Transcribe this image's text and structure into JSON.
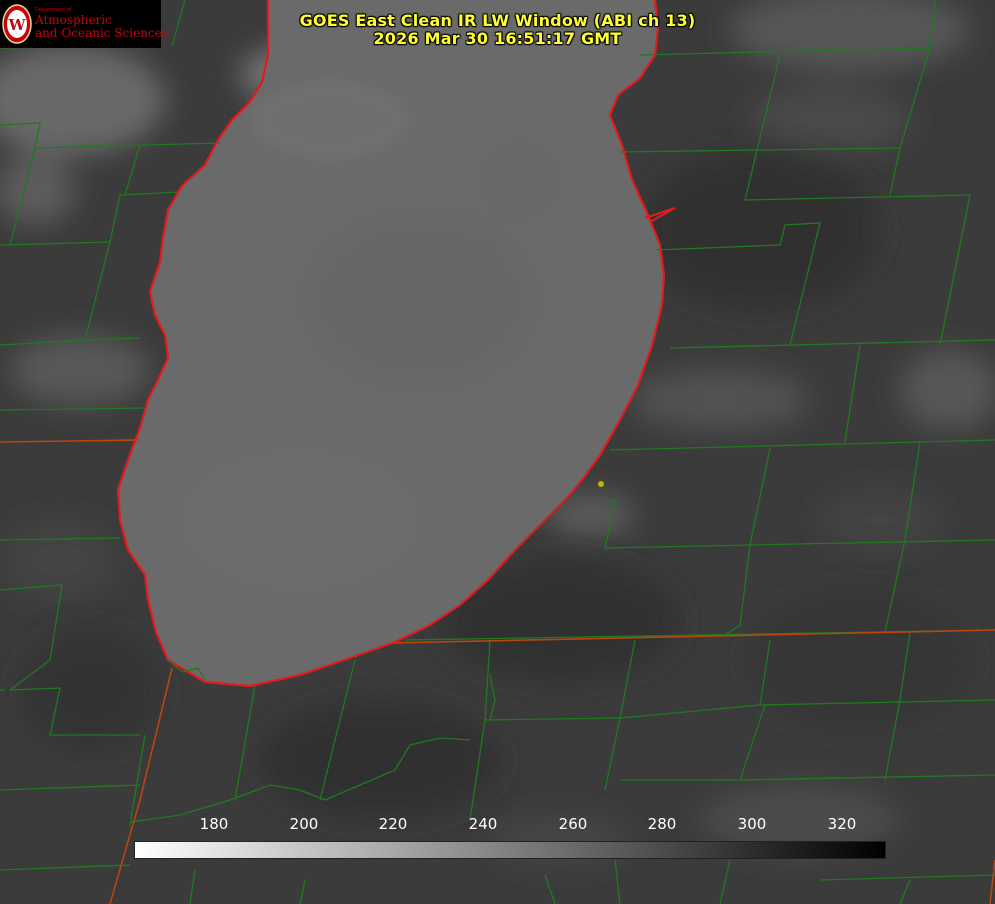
{
  "title": {
    "main": "GOES East Clean IR LW Window (ABI ch 13)",
    "datetime": "2026 Mar 30 16:51:17 GMT"
  },
  "logo": {
    "department": "Department of",
    "line1": "Atmospheric",
    "line2": "and Oceanic Sciences",
    "seal_letter": "W"
  },
  "colorbar": {
    "ticks": [
      "180",
      "200",
      "220",
      "240",
      "260",
      "280",
      "300",
      "320"
    ],
    "gradient": "white-to-black"
  },
  "colors": {
    "title_text": "#ffff33",
    "county_lines": "#1f7a1f",
    "state_lines": "#b8460f",
    "lake_outline": "#e41a1c",
    "station_marker": "#c8b400",
    "logo_red": "#c5050c"
  },
  "icons": {
    "seal": "uw-crest-icon",
    "station": "station-dot-icon"
  }
}
